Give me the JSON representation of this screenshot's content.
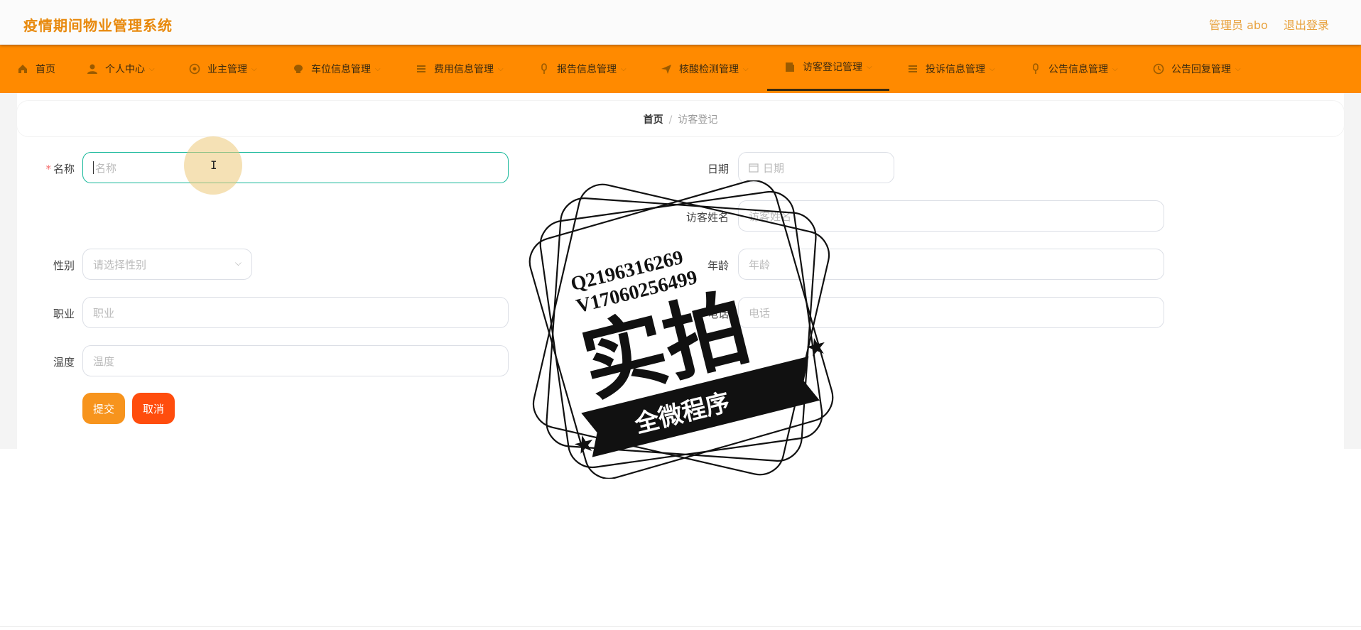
{
  "app": {
    "title": "疫情期间物业管理系统"
  },
  "header": {
    "user": "管理员 abo",
    "logout": "退出登录"
  },
  "nav": {
    "items": [
      {
        "label": "首页",
        "icon": "home-icon"
      },
      {
        "label": "个人中心",
        "icon": "user-icon"
      },
      {
        "label": "业主管理",
        "icon": "owner-icon"
      },
      {
        "label": "车位信息管理",
        "icon": "parking-icon"
      },
      {
        "label": "费用信息管理",
        "icon": "fee-icon"
      },
      {
        "label": "报告信息管理",
        "icon": "report-icon"
      },
      {
        "label": "核酸检测管理",
        "icon": "test-icon"
      },
      {
        "label": "访客登记管理",
        "icon": "visitor-icon",
        "active": true
      },
      {
        "label": "投诉信息管理",
        "icon": "complaint-icon"
      },
      {
        "label": "公告信息管理",
        "icon": "notice-icon"
      },
      {
        "label": "公告回复管理",
        "icon": "reply-icon"
      }
    ]
  },
  "breadcrumb": {
    "home": "首页",
    "separator": "/",
    "current": "访客登记"
  },
  "form": {
    "name": {
      "label": "名称",
      "placeholder": "名称",
      "required": true
    },
    "date": {
      "label": "日期",
      "placeholder": "日期"
    },
    "visitor_name": {
      "label": "访客姓名",
      "placeholder": "访客姓名"
    },
    "gender": {
      "label": "性别",
      "placeholder": "请选择性别"
    },
    "age": {
      "label": "年龄",
      "placeholder": "年龄"
    },
    "job": {
      "label": "职业",
      "placeholder": "职业"
    },
    "phone": {
      "label": "电话",
      "placeholder": "电话"
    },
    "temperature": {
      "label": "温度",
      "placeholder": "温度"
    },
    "submit": "提交",
    "cancel": "取消"
  },
  "watermark": {
    "line1": "Q2196316269",
    "line2": "V17060256499",
    "big": "实拍",
    "banner": "全微程序"
  },
  "colors": {
    "accent": "#ff8a00",
    "title": "#e8890c",
    "submit": "#f7941d",
    "cancel": "#ff4d0d",
    "focus": "#17b89a"
  }
}
